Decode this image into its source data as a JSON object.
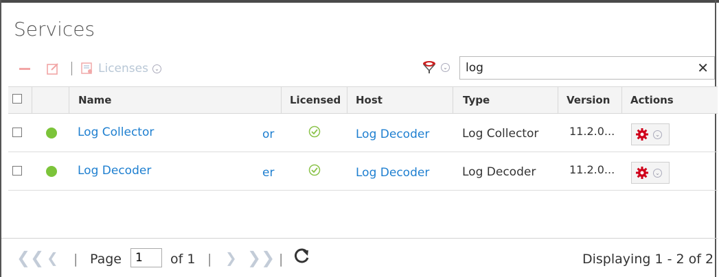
{
  "page": {
    "title": "Services"
  },
  "toolbar": {
    "licenses_label": "Licenses"
  },
  "search": {
    "value": "log"
  },
  "table": {
    "headers": {
      "name": "Name",
      "licensed": "Licensed",
      "host": "Host",
      "type": "Type",
      "version": "Version",
      "actions": "Actions"
    },
    "rows": [
      {
        "name": "Log Collector",
        "name_tail": "or",
        "licensed": true,
        "host": "Log Decoder",
        "type": "Log Collector",
        "version": "11.2.0...",
        "status_color": "#7cc43a"
      },
      {
        "name": "Log Decoder",
        "name_tail": "er",
        "licensed": true,
        "host": "Log Decoder",
        "type": "Log Decoder",
        "version": "11.2.0...",
        "status_color": "#7cc43a"
      }
    ]
  },
  "pager": {
    "page_label": "Page",
    "page_value": "1",
    "of_label": "of 1",
    "displaying": "Displaying 1 - 2 of 2"
  },
  "icons": [
    "remove-icon",
    "edit-icon",
    "licenses-icon",
    "filter-icon",
    "chevron-down-icon",
    "close-icon",
    "check-icon",
    "gear-icon",
    "first-page-icon",
    "prev-page-icon",
    "next-page-icon",
    "last-page-icon",
    "refresh-icon"
  ],
  "colors": {
    "link": "#1e7fd0",
    "status_ok": "#7cc43a",
    "gear": "#d0021b",
    "check": "#8bc34a"
  }
}
